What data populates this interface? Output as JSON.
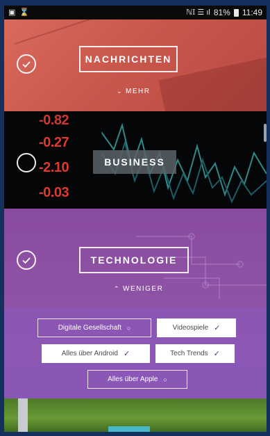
{
  "status_bar": {
    "left_icons": [
      "gallery-icon",
      "hourglass-icon"
    ],
    "signal_text": "ℕ𝕀 ☰ ıl",
    "battery": "81%",
    "time": "11:49"
  },
  "sections": {
    "news": {
      "title": "NACHRICHTEN",
      "toggle": "MEHR",
      "selected": true
    },
    "business": {
      "title": "BUSINESS",
      "selected": false,
      "tickers": [
        "-0.82",
        "-0.27",
        "-2.10",
        "-0.03"
      ]
    },
    "technology": {
      "title": "TECHNOLOGIE",
      "toggle": "WENIGER",
      "selected": true,
      "subtopics": [
        {
          "label": "Digitale Gesellschaft",
          "selected": false
        },
        {
          "label": "Videospiele",
          "selected": true
        },
        {
          "label": "Alles über Android",
          "selected": true
        },
        {
          "label": "Tech Trends",
          "selected": true
        },
        {
          "label": "Alles über Apple",
          "selected": false
        }
      ]
    }
  },
  "colors": {
    "news_bg": "#d0605a",
    "tech_bg": "#8c50a3",
    "ticker_red": "#e0372f",
    "chip_check": "#5a2f74"
  }
}
